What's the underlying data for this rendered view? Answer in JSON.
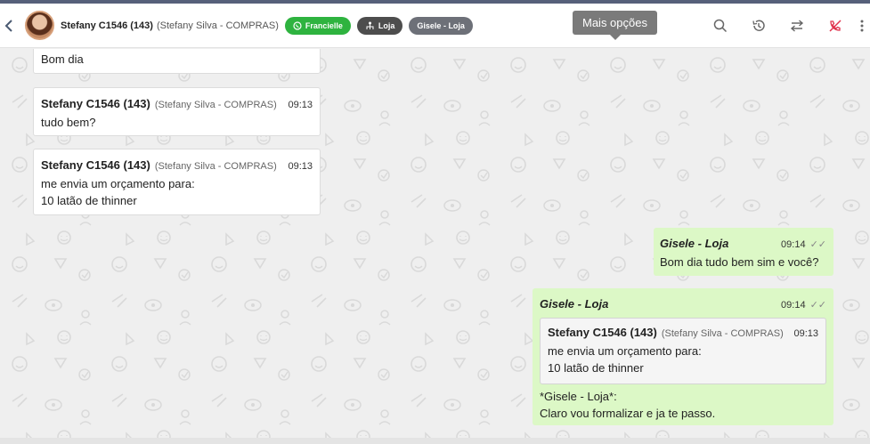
{
  "header": {
    "contact_name": "Stefany C1546 (143)",
    "contact_sub": "(Stefany Silva - COMPRAS)",
    "tags": [
      {
        "label": "Francielle",
        "icon": "whatsapp-icon",
        "color": "#2eb33f"
      },
      {
        "label": "Loja",
        "icon": "hierarchy-icon",
        "color": "#4d4d4d"
      },
      {
        "label": "Gisele - Loja",
        "icon": "",
        "color": "#6d7078"
      }
    ],
    "icons": [
      "search-icon",
      "history-icon",
      "transfer-icon",
      "end-call-icon",
      "more-options-icon"
    ],
    "tooltip": "Mais opções"
  },
  "messages": [
    {
      "text": "Bom dia"
    },
    {
      "author": "Stefany C1546 (143)",
      "author_sub": "(Stefany Silva - COMPRAS)",
      "time": "09:13",
      "lines": [
        "tudo bem?"
      ]
    },
    {
      "author": "Stefany C1546 (143)",
      "author_sub": "(Stefany Silva - COMPRAS)",
      "time": "09:13",
      "lines": [
        "me envia um orçamento para:",
        "10 latão de thinner"
      ]
    },
    {
      "author": "Gisele - Loja",
      "time": "09:14",
      "lines": [
        "Bom dia tudo bem sim e você?"
      ]
    },
    {
      "author": "Gisele - Loja",
      "time": "09:14",
      "quote": {
        "author": "Stefany C1546 (143)",
        "author_sub": "(Stefany Silva - COMPRAS)",
        "time": "09:13",
        "lines": [
          "me envia um orçamento para:",
          "10 latão de thinner"
        ]
      },
      "lines": [
        "*Gisele - Loja*:",
        "Claro vou formalizar e ja te passo."
      ]
    }
  ],
  "colors": {
    "outgoing": "#dcf8c6",
    "incoming": "#ffffff",
    "background": "#efefef",
    "end_call": "#e0334d"
  }
}
